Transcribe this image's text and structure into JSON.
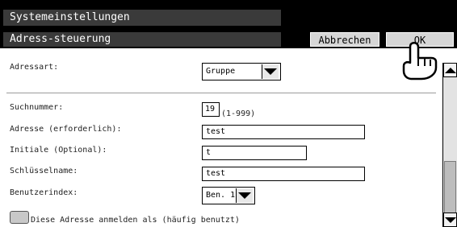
{
  "header": {
    "title": "Systemeinstellungen",
    "subtitle": "Adress-steuerung",
    "cancel_label": "Abbrechen",
    "ok_label": "OK"
  },
  "form": {
    "address_type": {
      "label": "Adressart:",
      "value": "Gruppe"
    },
    "search_number": {
      "label": "Suchnummer:",
      "value": "19",
      "range": "(1-999)"
    },
    "address": {
      "label": "Adresse (erforderlich):",
      "value": "test"
    },
    "initial": {
      "label": "Initiale (Optional):",
      "value": "t"
    },
    "key_name": {
      "label": "Schlüsselname:",
      "value": "test"
    },
    "user_index": {
      "label": "Benutzerindex:",
      "value": "Ben. 1"
    },
    "register_frequent": {
      "label": "Diese Adresse anmelden als (häufig benutzt)",
      "checked": false
    }
  },
  "icons": {
    "cursor": "hand-pointer-icon",
    "dropdown": "triangle-down-icon",
    "scroll_up": "triangle-up-icon",
    "scroll_down": "triangle-down-icon"
  },
  "colors": {
    "title_bar": "#000000",
    "plate": "#3a3a3a",
    "button": "#d6d6d6"
  }
}
